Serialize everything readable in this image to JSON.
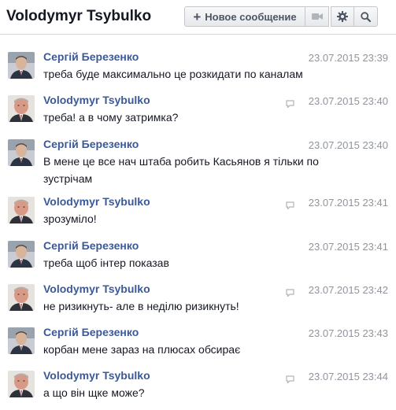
{
  "header": {
    "title": "Volodymyr Tsybulko",
    "new_message_label": "Новое сообщение"
  },
  "messages": [
    {
      "sender": "Сергій Березенко",
      "time": "23.07.2015 23:39",
      "text": "треба буде максимально це розкидати по каналам",
      "avatar": "berezenko",
      "seen": false
    },
    {
      "sender": "Volodymyr Tsybulko",
      "time": "23.07.2015 23:40",
      "text": "треба! а в чому затримка?",
      "avatar": "tsybulko",
      "seen": true
    },
    {
      "sender": "Сергій Березенко",
      "time": "23.07.2015 23:40",
      "text": "В мене це все нач штаба робить Касьянов я тільки по зустрічам",
      "avatar": "berezenko",
      "seen": false
    },
    {
      "sender": "Volodymyr Tsybulko",
      "time": "23.07.2015 23:41",
      "text": "зрозуміло!",
      "avatar": "tsybulko",
      "seen": true
    },
    {
      "sender": "Сергій Березенко",
      "time": "23.07.2015 23:41",
      "text": "треба щоб інтер показав",
      "avatar": "berezenko",
      "seen": false
    },
    {
      "sender": "Volodymyr Tsybulko",
      "time": "23.07.2015 23:42",
      "text": "не ризикнуть- але в неділю ризикнуть!",
      "avatar": "tsybulko",
      "seen": true
    },
    {
      "sender": "Сергій Березенко",
      "time": "23.07.2015 23:43",
      "text": "корбан мене зараз на плюсах обсирає",
      "avatar": "berezenko",
      "seen": false
    },
    {
      "sender": "Volodymyr Tsybulko",
      "time": "23.07.2015 23:44",
      "text": "а що він щке може?",
      "avatar": "tsybulko",
      "seen": true
    }
  ]
}
